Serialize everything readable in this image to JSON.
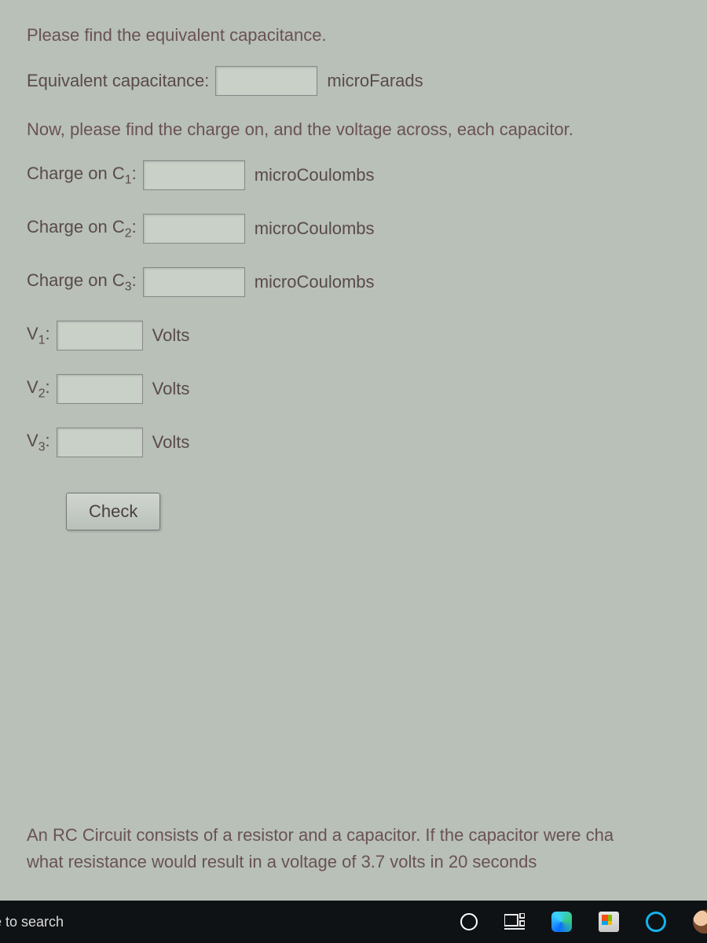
{
  "content": {
    "instruction1": "Please find the equivalent capacitance.",
    "eq_cap_label": "Equivalent capacitance:",
    "eq_cap_unit": "microFarads",
    "instruction2": "Now, please find the charge on, and the voltage across, each capacitor.",
    "q1_label_pre": "Charge on C",
    "q1_sub": "1",
    "q2_sub": "2",
    "q3_sub": "3",
    "colon": ":",
    "q_unit": "microCoulombs",
    "v_label_pre": "V",
    "v1_sub": "1",
    "v2_sub": "2",
    "v3_sub": "3",
    "v_unit": "Volts",
    "check_label": "Check",
    "rc_text_line1": "An RC Circuit consists of a resistor and a capacitor.  If the capacitor were cha",
    "rc_text_line2": "what resistance would result in a voltage of 3.7 volts in 20 seconds"
  },
  "taskbar": {
    "search_text": "e to search"
  }
}
